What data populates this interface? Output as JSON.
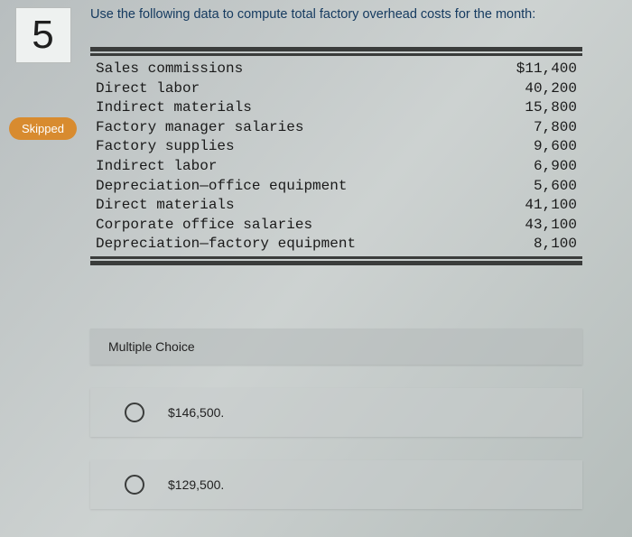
{
  "question_number": "5",
  "skipped_label": "Skipped",
  "prompt": "Use the following data to compute total factory overhead costs for the month:",
  "table": {
    "rows": [
      {
        "label": "Sales commissions",
        "value": "$11,400"
      },
      {
        "label": "Direct labor",
        "value": "40,200"
      },
      {
        "label": "Indirect materials",
        "value": "15,800"
      },
      {
        "label": "Factory manager salaries",
        "value": "7,800"
      },
      {
        "label": "Factory supplies",
        "value": "9,600"
      },
      {
        "label": "Indirect labor",
        "value": "6,900"
      },
      {
        "label": "Depreciation—office equipment",
        "value": "5,600"
      },
      {
        "label": "Direct materials",
        "value": "41,100"
      },
      {
        "label": "Corporate office salaries",
        "value": "43,100"
      },
      {
        "label": "Depreciation—factory equipment",
        "value": "8,100"
      }
    ]
  },
  "mc_header": "Multiple Choice",
  "options": [
    {
      "text": "$146,500."
    },
    {
      "text": "$129,500."
    }
  ]
}
